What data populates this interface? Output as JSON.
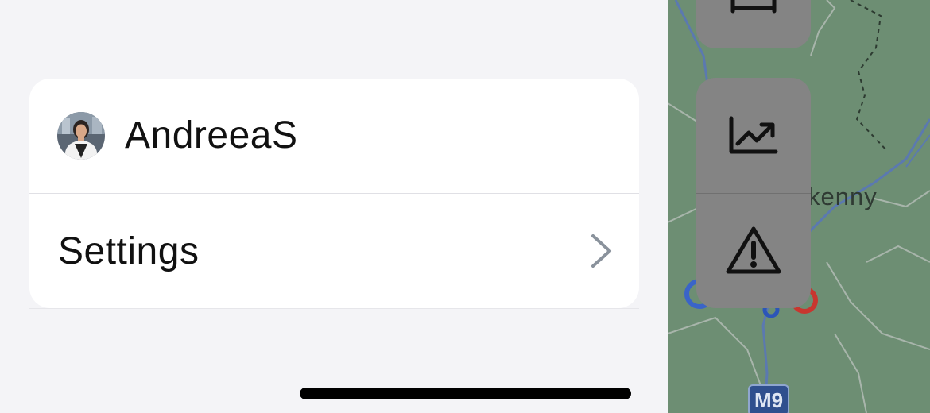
{
  "profile": {
    "name": "AndreeaS",
    "avatar_icon": "user-avatar-icon"
  },
  "menu": {
    "settings_label": "Settings",
    "settings_chevron_icon": "chevron-right-icon"
  },
  "map": {
    "place_label": "kenny",
    "road_shield": "M9",
    "buttons": [
      {
        "name": "bed-icon"
      },
      {
        "name": "trending-up-icon"
      },
      {
        "name": "warning-icon"
      }
    ]
  },
  "colors": {
    "background": "#f4f4f7",
    "card": "#ffffff",
    "map": "#6d8e73",
    "map_button": "#848484"
  }
}
